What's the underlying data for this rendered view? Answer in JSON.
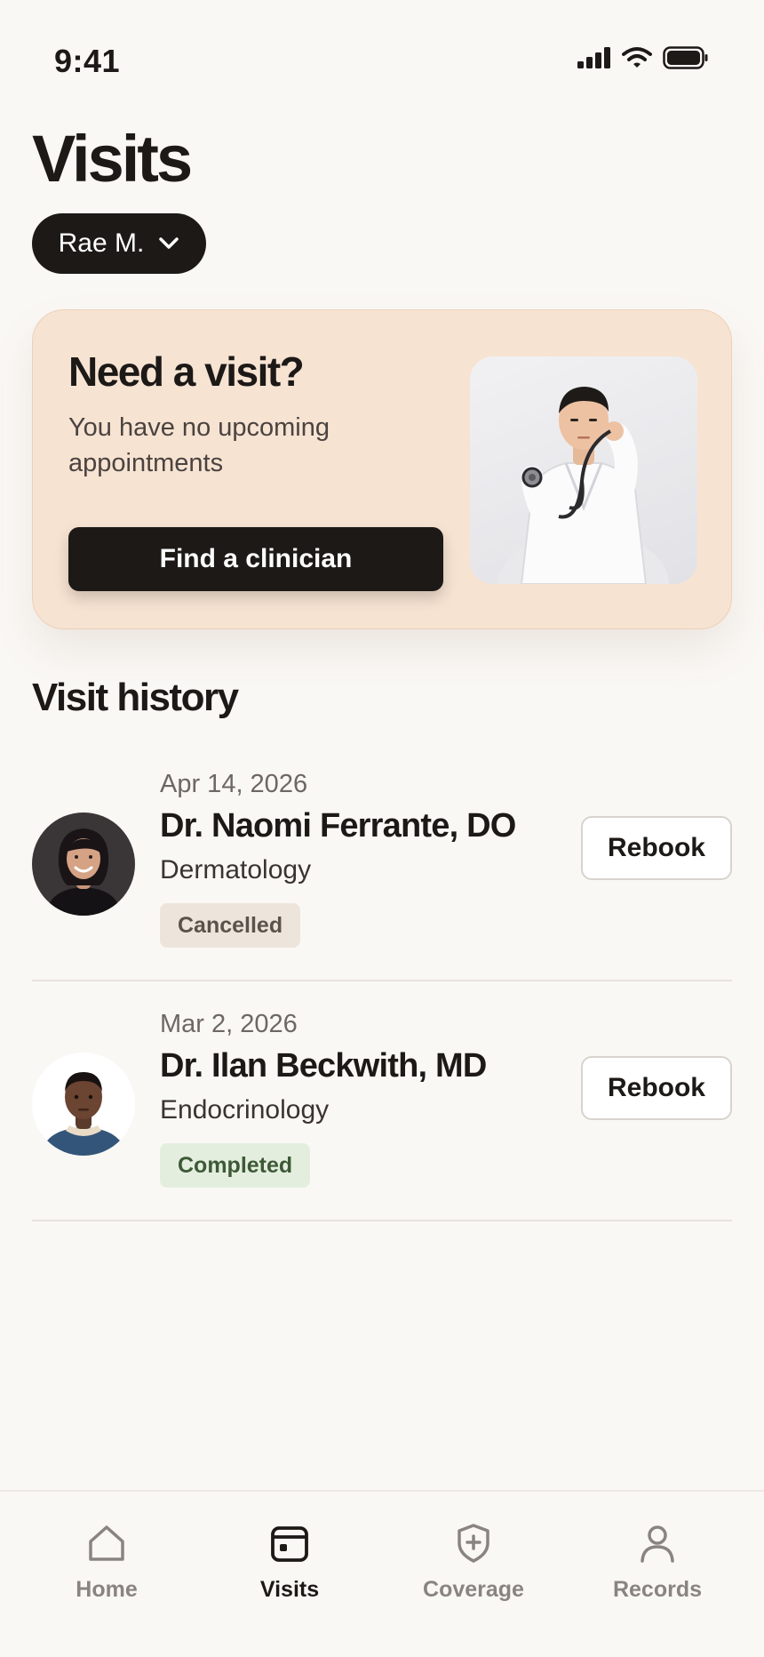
{
  "status_bar": {
    "time": "9:41"
  },
  "header": {
    "title": "Visits",
    "profile_name": "Rae M."
  },
  "promo": {
    "heading": "Need a visit?",
    "subtext": "You have no upcoming appointments",
    "button_label": "Find a clinician"
  },
  "history": {
    "title": "Visit history",
    "visits": [
      {
        "date": "Apr 14, 2026",
        "doctor": "Dr. Naomi Ferrante, DO",
        "specialty": "Dermatology",
        "status": "Cancelled",
        "action": "Rebook"
      },
      {
        "date": "Mar 2, 2026",
        "doctor": "Dr. Ilan Beckwith, MD",
        "specialty": "Endocrinology",
        "status": "Completed",
        "action": "Rebook"
      }
    ]
  },
  "tab_bar": {
    "tabs": [
      {
        "label": "Home",
        "icon": "home-icon",
        "active": false
      },
      {
        "label": "Visits",
        "icon": "calendar-icon",
        "active": true
      },
      {
        "label": "Coverage",
        "icon": "shield-plus-icon",
        "active": false
      },
      {
        "label": "Records",
        "icon": "person-icon",
        "active": false
      }
    ]
  },
  "colors": {
    "background": "#FAF8F5",
    "primary_dark": "#1C1917",
    "promo_card": "#F7E3D2",
    "badge_cancelled": "#EDE5DB",
    "badge_completed": "#E4EEDF",
    "tab_inactive": "#8A8480"
  }
}
